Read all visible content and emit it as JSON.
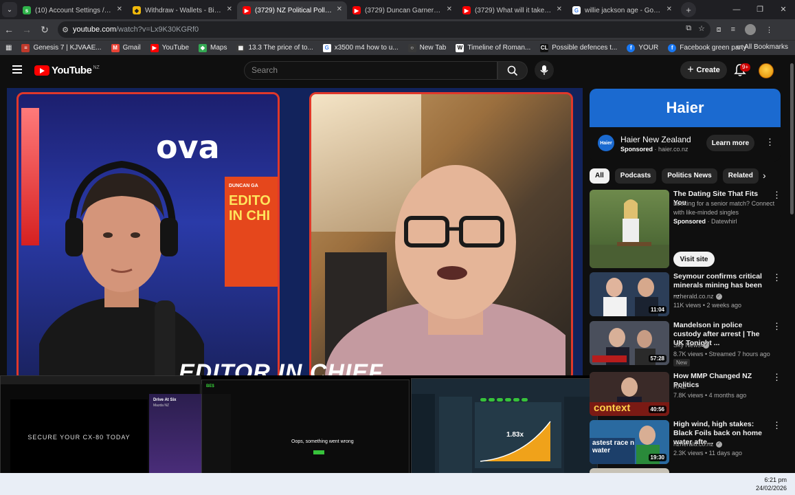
{
  "browser": {
    "tabs": [
      {
        "title": "(10) Account Settings / Stream",
        "fav_color": "#2fb34a",
        "fav": "s"
      },
      {
        "title": "Withdraw - Wallets - Binance",
        "fav_color": "#f0b90b",
        "fav": "◆"
      },
      {
        "title": "(3729) NZ Political Polls: Why",
        "fav_color": "#ff0000",
        "fav": "▶"
      },
      {
        "title": "(3729) Duncan Garner Podcast",
        "fav_color": "#ff0000",
        "fav": "▶"
      },
      {
        "title": "(3729) What will it take for dog",
        "fav_color": "#ff0000",
        "fav": "▶"
      },
      {
        "title": "willie jackson age - Google Sea",
        "fav_color": "#ffffff",
        "fav": "G"
      }
    ],
    "url_host": "youtube.com",
    "url_path": "/watch?v=Lx9K30KGRf0",
    "bookmarks": [
      {
        "label": "Genesis 7 | KJVAAE...",
        "color": "#c0392b",
        "ic": "≡"
      },
      {
        "label": "Gmail",
        "color": "#ea4335",
        "ic": "M"
      },
      {
        "label": "YouTube",
        "color": "#ff0000",
        "ic": "▶"
      },
      {
        "label": "Maps",
        "color": "#34a853",
        "ic": "◆"
      },
      {
        "label": "13.3 The price of to...",
        "color": "#3a3a3a",
        "ic": "▦"
      },
      {
        "label": "x3500 m4 how to u...",
        "color": "#ffffff",
        "ic": "G"
      },
      {
        "label": "New Tab",
        "color": "#3a3a3a",
        "ic": "○"
      },
      {
        "label": "Timeline of Roman...",
        "color": "#ffffff",
        "ic": "W"
      },
      {
        "label": "Possible defences t...",
        "color": "#111111",
        "ic": "CL"
      },
      {
        "label": "YOUR",
        "color": "#1877f2",
        "ic": "f"
      },
      {
        "label": "Facebook green party",
        "color": "#1877f2",
        "ic": "f"
      }
    ],
    "all_bookmarks": "All Bookmarks"
  },
  "youtube": {
    "logo": "YouTube",
    "region": "NZ",
    "search_placeholder": "Search",
    "create_label": "Create",
    "notif_count": "9+"
  },
  "video": {
    "overlay_text": "EDITOR IN CHIEF",
    "bg_brand": "ova",
    "card_small": "DUNCAN GA",
    "card_big": "EDITO IN CHI"
  },
  "thumbnails": {
    "ad_text": "SECURE YOUR CX-80 TODAY",
    "ad_side_title": "Drive At Six",
    "ad_side_sub": "Mazda NZ",
    "site_logo": "BE$",
    "error_text": "Oops, something went wrong",
    "multiplier": "1.83x"
  },
  "ad": {
    "banner": "Haier",
    "logo": "Haier",
    "name": "Haier New Zealand",
    "sponsored": "Sponsored",
    "domain": "haier.co.nz",
    "cta": "Learn more"
  },
  "chips": [
    "All",
    "Podcasts",
    "Politics News",
    "Related"
  ],
  "items": [
    {
      "title": "The Dating Site That Fits You",
      "line1": "Looking for a senior match? Connect with like-minded singles",
      "sponsored": "Sponsored",
      "source": "Datewhirl",
      "cta": "Visit site"
    },
    {
      "title": "Seymour confirms critical minerals mining has been ...",
      "channel": "nzherald.co.nz",
      "stats": "11K views • 2 weeks ago",
      "duration": "11:04"
    },
    {
      "title": "Mandelson in police custody after arrest | The UK Tonight ...",
      "channel": "Sky News",
      "stats": "8.7K views • Streamed 7 hours ago",
      "badge": "New",
      "duration": "57:28"
    },
    {
      "title": "How MMP Changed NZ Politics",
      "channel": "RNZ",
      "stats": "7.8K views • 4 months ago",
      "duration": "40:56",
      "thumb_text": "context"
    },
    {
      "title": "High wind, high stakes: Black Foils back on home water afte...",
      "channel": "nzherald.co.nz",
      "stats": "2.3K views • 11 days ago",
      "duration": "19:30",
      "thumb_text": "astest race n water"
    }
  ],
  "taskbar": {
    "time": "6:21 pm",
    "date": "24/02/2026"
  }
}
